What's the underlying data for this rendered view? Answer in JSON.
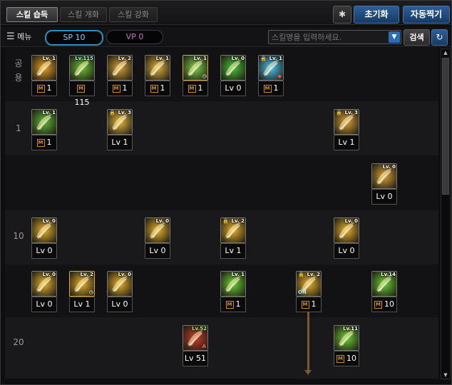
{
  "tabs": [
    {
      "label": "스킬 습득",
      "active": true
    },
    {
      "label": "스킬 개화",
      "active": false
    },
    {
      "label": "스킬 강화",
      "active": false
    }
  ],
  "buttons": {
    "reset": "초기화",
    "auto_assign": "자동찍기",
    "search": "검색"
  },
  "menu": {
    "label": "메뉴",
    "sp": "SP 10",
    "vp": "VP 0"
  },
  "search": {
    "placeholder": "스킬명을 입력하세요."
  },
  "rows": [
    {
      "label": "공\n용"
    },
    {
      "label": "1"
    },
    {
      "label": ""
    },
    {
      "label": "10"
    },
    {
      "label": ""
    },
    {
      "label": "20"
    }
  ],
  "skills": [
    {
      "id": "s1",
      "tag": "Lv. 1",
      "value": "1",
      "mastery": true,
      "color": "#e8a22a",
      "locked": false
    },
    {
      "id": "s2",
      "tag": "Lv.115",
      "value": "115",
      "mastery": true,
      "color": "#6fbf3a",
      "locked": false
    },
    {
      "id": "s3",
      "tag": "Lv. 2",
      "value": "1",
      "mastery": true,
      "color": "#d7a13a",
      "locked": false
    },
    {
      "id": "s4",
      "tag": "Lv. 1",
      "value": "1",
      "mastery": true,
      "color": "#e0b040",
      "locked": false
    },
    {
      "id": "s5",
      "tag": "Lv. 1",
      "value": "1",
      "mastery": true,
      "color": "#7fcf4a",
      "locked": false
    },
    {
      "id": "s6",
      "tag": "Lv. 0",
      "value": "Lv 0",
      "mastery": false,
      "color": "#4ec23a",
      "locked": false
    },
    {
      "id": "s7",
      "tag": "Lv. 1",
      "value": "1",
      "mastery": true,
      "color": "#4fc3f0",
      "locked": true
    },
    {
      "id": "s8",
      "tag": "Lv. 1",
      "value": "1",
      "mastery": true,
      "color": "#62b83a",
      "locked": false
    },
    {
      "id": "s9",
      "tag": "Lv. 3",
      "value": "Lv 1",
      "mastery": false,
      "color": "#e8b640",
      "locked": true
    },
    {
      "id": "s10",
      "tag": "Lv. 3",
      "value": "Lv 1",
      "mastery": false,
      "color": "#d9a03a",
      "locked": true
    },
    {
      "id": "s11",
      "tag": "Lv. 0",
      "value": "Lv 0",
      "mastery": false,
      "color": "#d9a03a",
      "locked": false
    },
    {
      "id": "s12",
      "tag": "Lv. 0",
      "value": "Lv 0",
      "mastery": false,
      "color": "#e6b030",
      "locked": false
    },
    {
      "id": "s13",
      "tag": "Lv. 0",
      "value": "Lv 0",
      "mastery": false,
      "color": "#e6b030",
      "locked": false
    },
    {
      "id": "s14",
      "tag": "Lv. 2",
      "value": "Lv 1",
      "mastery": false,
      "color": "#e6b030",
      "locked": true
    },
    {
      "id": "s15",
      "tag": "Lv. 0",
      "value": "Lv 0",
      "mastery": false,
      "color": "#e6b030",
      "locked": false
    },
    {
      "id": "s16",
      "tag": "Lv. 0",
      "value": "Lv 0",
      "mastery": false,
      "color": "#e6b030",
      "locked": false
    },
    {
      "id": "s17",
      "tag": "Lv. 2",
      "value": "Lv 1",
      "mastery": false,
      "color": "#e6b030",
      "locked": false
    },
    {
      "id": "s18",
      "tag": "Lv. 0",
      "value": "Lv 0",
      "mastery": false,
      "color": "#e6b030",
      "locked": false
    },
    {
      "id": "s19",
      "tag": "Lv. 1",
      "value": "1",
      "mastery": true,
      "color": "#6fcf3a",
      "locked": false
    },
    {
      "id": "s20",
      "tag": "Lv. 2",
      "value": "1",
      "mastery": true,
      "color": "#e6b030",
      "locked": true
    },
    {
      "id": "s21",
      "tag": "Lv.14",
      "value": "10",
      "mastery": true,
      "color": "#6fcf3a",
      "locked": false
    },
    {
      "id": "s22",
      "tag": "Lv.52",
      "value": "Lv 51",
      "mastery": false,
      "color": "#c8402a",
      "locked": false
    },
    {
      "id": "s23",
      "tag": "Lv.11",
      "value": "10",
      "mastery": true,
      "color": "#6fcf3a",
      "locked": false
    }
  ]
}
